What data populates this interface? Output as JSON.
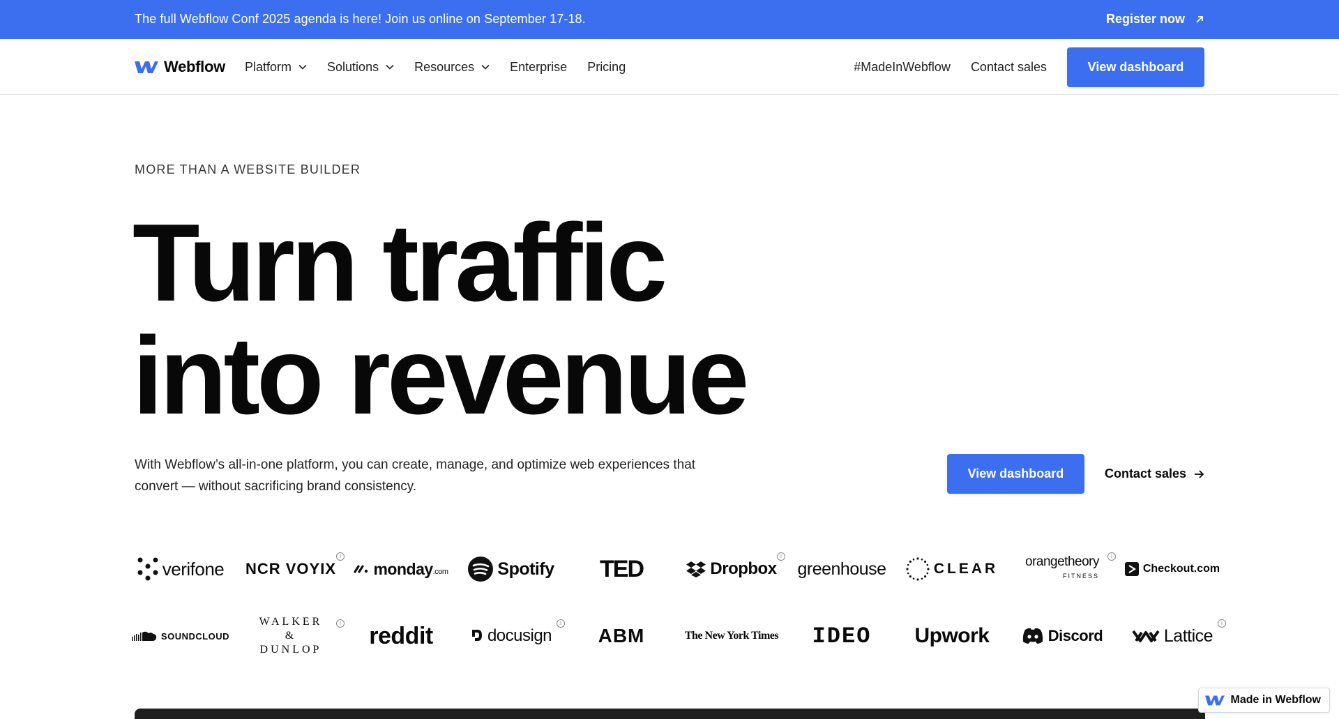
{
  "announcement": {
    "text": "The full Webflow Conf 2025 agenda is here! Join us online on September 17-18.",
    "link_label": "Register now"
  },
  "nav": {
    "logo_text": "Webflow",
    "items": [
      {
        "label": "Platform",
        "dropdown": true
      },
      {
        "label": "Solutions",
        "dropdown": true
      },
      {
        "label": "Resources",
        "dropdown": true
      },
      {
        "label": "Enterprise",
        "dropdown": false
      },
      {
        "label": "Pricing",
        "dropdown": false
      }
    ],
    "right": {
      "made_in": "#MadeInWebflow",
      "contact": "Contact sales",
      "cta": "View dashboard"
    }
  },
  "hero": {
    "eyebrow": "MORE THAN A WEBSITE BUILDER",
    "headline_line1": "Turn traffic",
    "headline_line2": "into revenue",
    "subtext": "With Webflow’s all-in-one platform, you can create, manage, and optimize web experiences that convert — without sacrificing brand consistency.",
    "cta_primary": "View dashboard",
    "cta_secondary": "Contact sales"
  },
  "logos": {
    "row1": [
      "verifone",
      "NCR VOYIX",
      "monday",
      "Spotify",
      "TED",
      "Dropbox",
      "greenhouse",
      "CLEAR",
      "orangetheory",
      "Checkout.com"
    ],
    "row2": [
      "SOUNDCLOUD",
      "WALKER & DUNLOP",
      "reddit",
      "docusign",
      "ABM",
      "The New York Times",
      "IDEO",
      "Upwork",
      "Discord",
      "Lattice"
    ],
    "monday_suffix": ".com",
    "orangetheory_sub": "FITNESS"
  },
  "badge": {
    "label": "Made in Webflow"
  },
  "colors": {
    "brand_blue": "#3b6ff0",
    "text": "#080808"
  }
}
